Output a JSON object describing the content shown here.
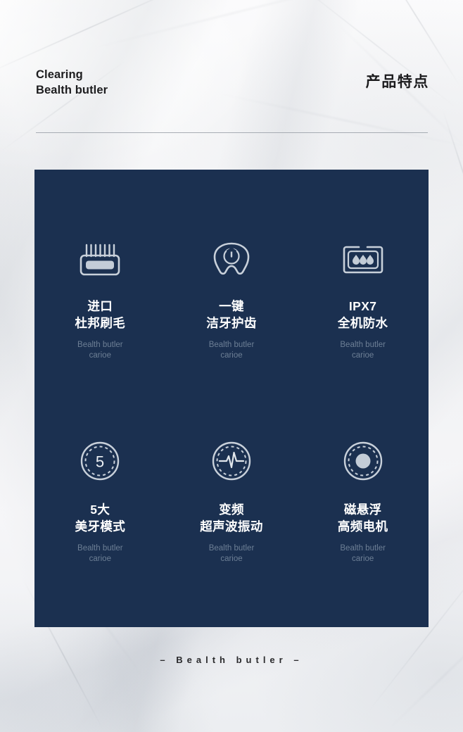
{
  "header": {
    "brand_line1": "Clearing",
    "brand_line2": "Bealth butler",
    "section_title": "产品特点"
  },
  "colors": {
    "panel_navy": "#1b3050",
    "background": "#f2f3f5",
    "title_white": "#ffffff",
    "subtitle_muted": "#6d7f95",
    "icon_stroke": "#c8d0da",
    "rule_gray": "#9aa0a8"
  },
  "features": [
    {
      "icon": "brush-head-icon",
      "title_line1": "进口",
      "title_line2": "杜邦刷毛",
      "sub_line1": "Bealth butler",
      "sub_line2": "carioe"
    },
    {
      "icon": "tooth-power-icon",
      "title_line1": "一键",
      "title_line2": "洁牙护齿",
      "sub_line1": "Bealth butler",
      "sub_line2": "carioe"
    },
    {
      "icon": "waterproof-droplets-icon",
      "title_line1": "IPX7",
      "title_line2": "全机防水",
      "sub_line1": "Bealth butler",
      "sub_line2": "carioe"
    },
    {
      "icon": "five-modes-dial-icon",
      "title_line1": "5大",
      "title_line2": "美牙模式",
      "sub_line1": "Bealth butler",
      "sub_line2": "carioe"
    },
    {
      "icon": "sonic-waveform-icon",
      "title_line1": "变频",
      "title_line2": "超声波振动",
      "sub_line1": "Bealth butler",
      "sub_line2": "carioe"
    },
    {
      "icon": "magnetic-motor-icon",
      "title_line1": "磁悬浮",
      "title_line2": "高频电机",
      "sub_line1": "Bealth butler",
      "sub_line2": "carioe"
    }
  ],
  "footer": {
    "dash_left": "–",
    "text": "Bealth  butler",
    "dash_right": "–"
  }
}
